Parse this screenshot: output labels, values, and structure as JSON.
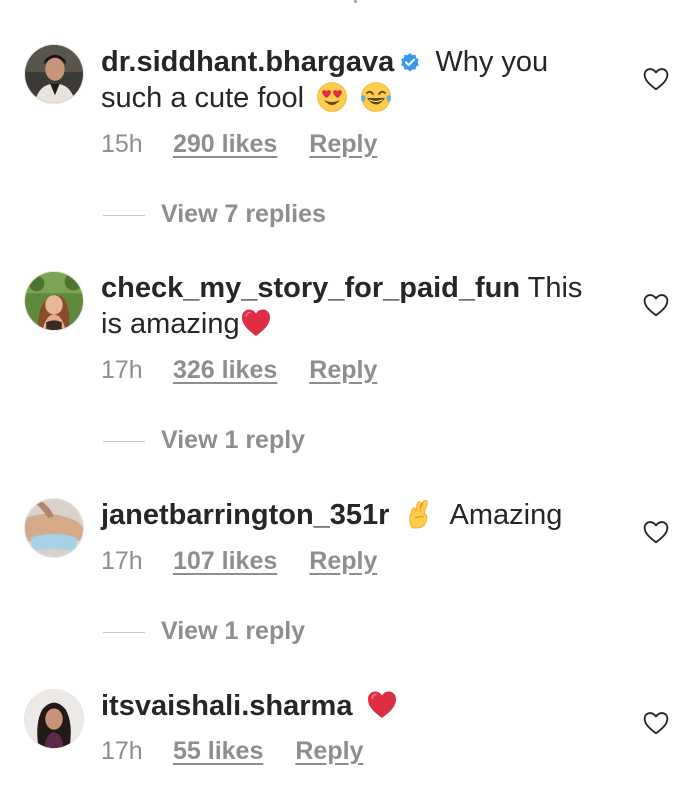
{
  "comments": [
    {
      "username": "dr.siddhant.bhargava",
      "verified": true,
      "text_line1": "Why you",
      "text_line2": "such a cute fool",
      "emojis": [
        "heart-eyes-emoji",
        "tears-of-joy-emoji"
      ],
      "time": "15h",
      "likes": "290 likes",
      "reply": "Reply",
      "view_replies": "View 7 replies"
    },
    {
      "username": "check_my_story_for_paid_fun",
      "verified": false,
      "text_line1": "This",
      "text_line2": "is amazing",
      "emojis": [
        "red-heart-emoji"
      ],
      "time": "17h",
      "likes": "326 likes",
      "reply": "Reply",
      "view_replies": "View 1 reply"
    },
    {
      "username": "janetbarrington_351r",
      "verified": false,
      "text_line1": "Amazing",
      "emojis": [
        "crossed-fingers-emoji"
      ],
      "time": "17h",
      "likes": "107 likes",
      "reply": "Reply",
      "view_replies": "View 1 reply"
    },
    {
      "username": "itsvaishali.sharma",
      "verified": false,
      "text_line1": "",
      "emojis": [
        "red-heart-emoji"
      ],
      "time": "17h",
      "likes": "55 likes",
      "reply": "Reply"
    }
  ],
  "icons": {
    "like": "heart-outline-icon",
    "verified": "verified-badge-icon"
  },
  "colors": {
    "text": "#262626",
    "secondary": "#8e8e8e",
    "verified": "#3897f0",
    "heart_emoji": "#e0245e"
  }
}
